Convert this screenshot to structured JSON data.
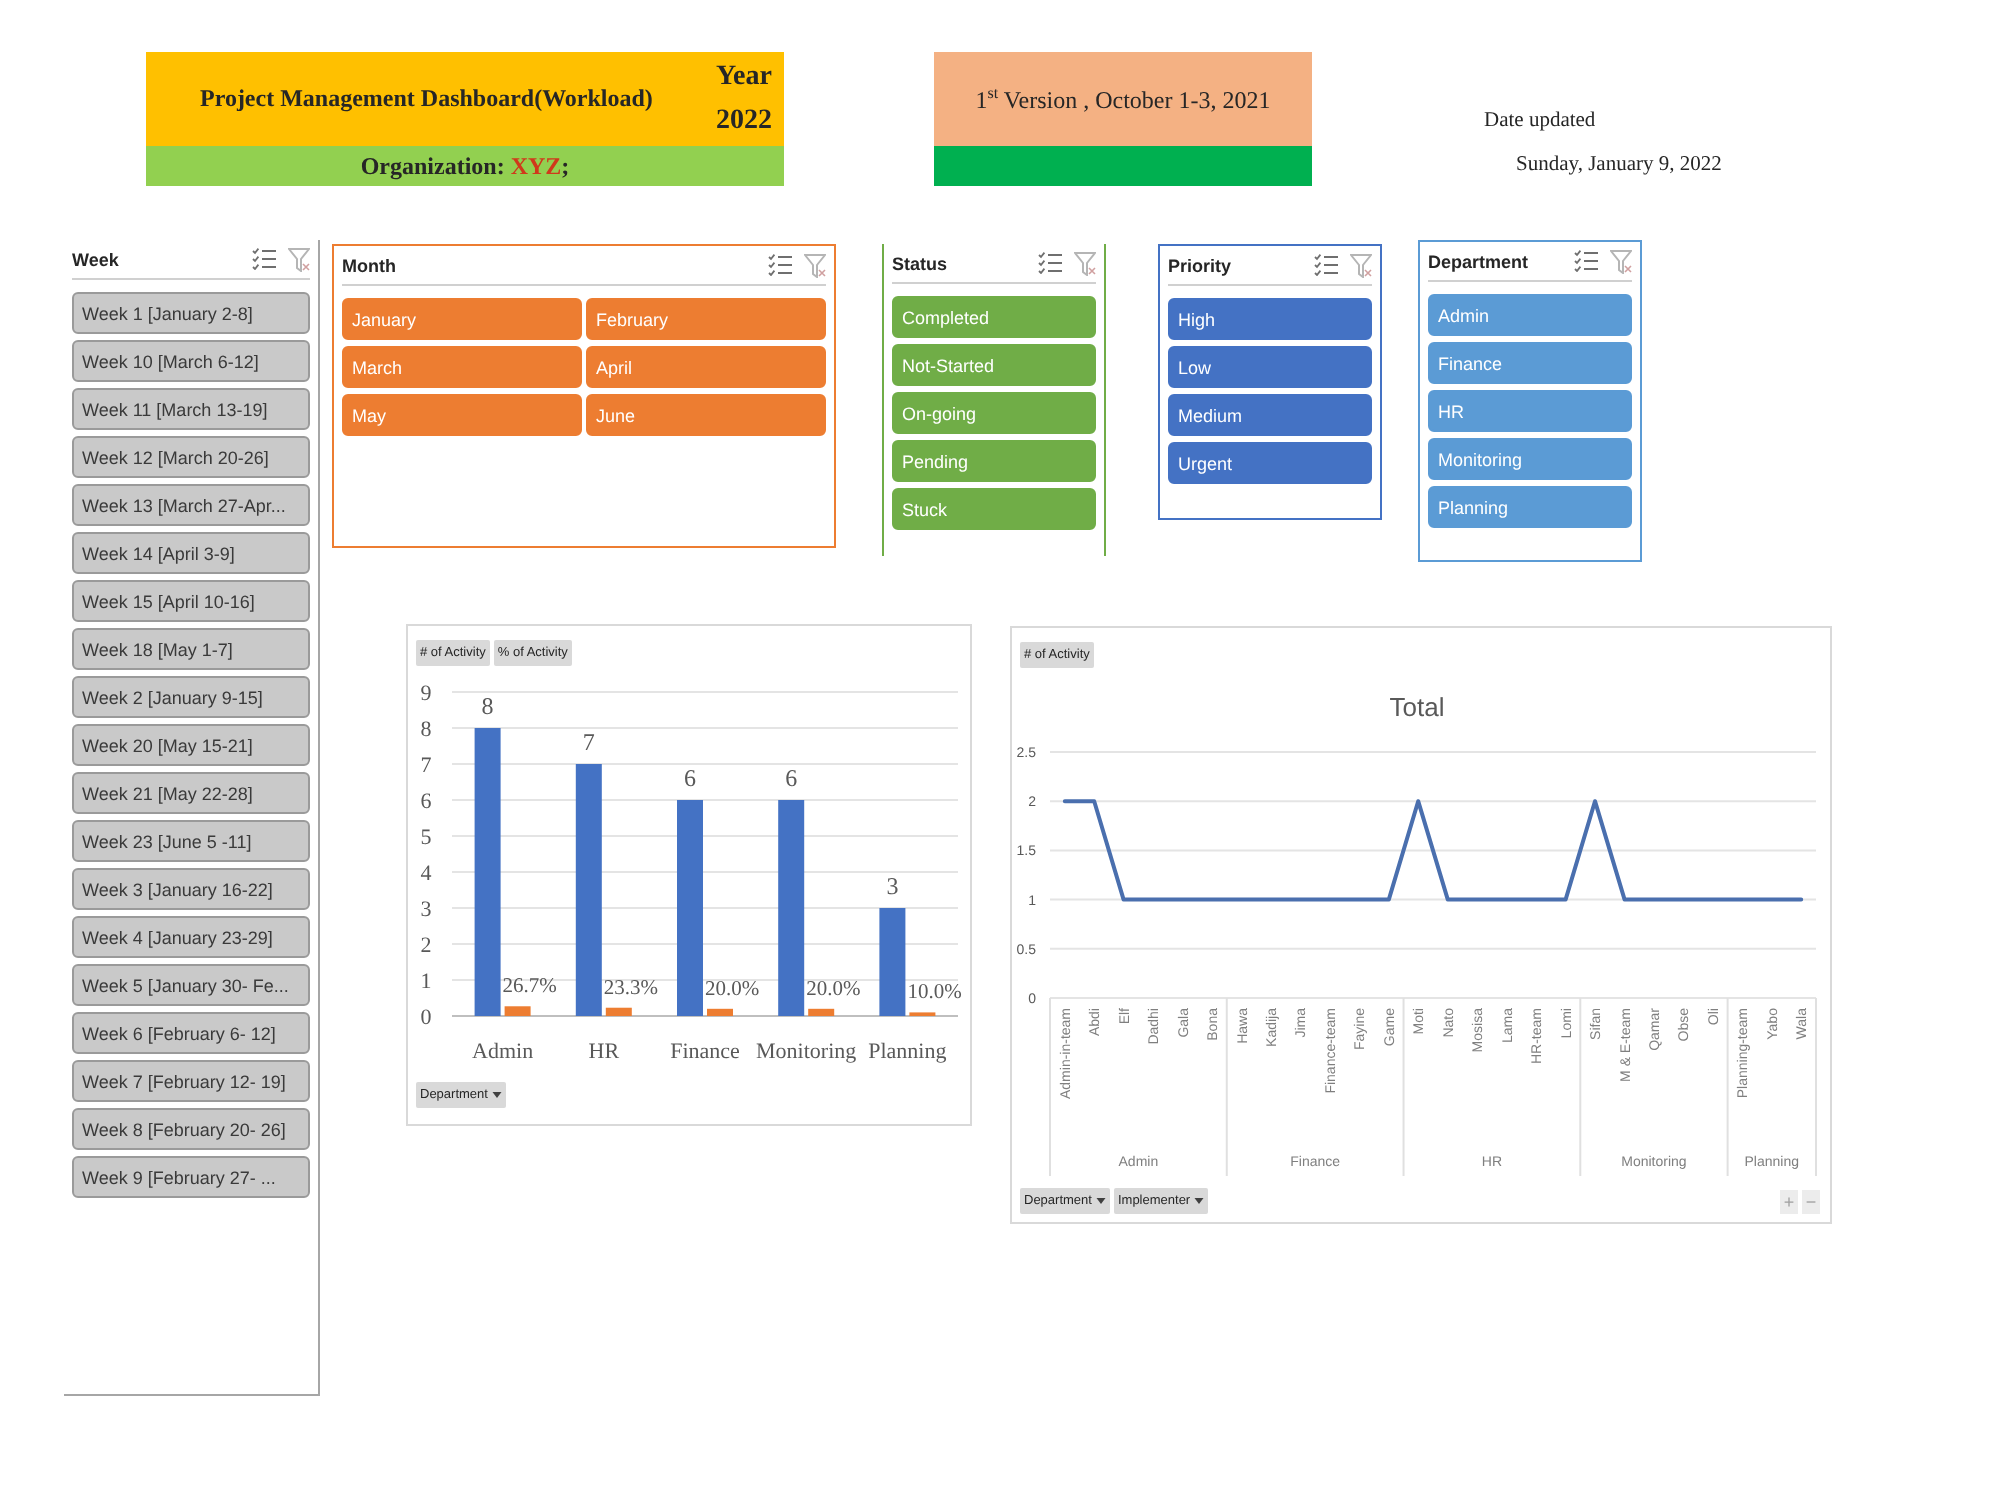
{
  "header": {
    "title": "Project Management Dashboard(Workload)",
    "year_label": "Year",
    "year": "2022",
    "organization": {
      "label": "Organization:",
      "value": "XYZ",
      "suffix": ";"
    }
  },
  "version": {
    "text": "1$^{st}$ Version , October 1-3, 2021"
  },
  "date_updated": {
    "label": "Date updated",
    "value": "Sunday, January 9, 2022"
  },
  "week_slicer": {
    "title": "Week",
    "items": [
      {
        "label": "Week 1 [January 2-8]",
        "selected": true
      },
      {
        "label": "Week 10 [March 6-12]",
        "selected": true
      },
      {
        "label": "Week 11 [March 13-19]",
        "selected": true
      },
      {
        "label": "Week 12 [March 20-26]",
        "selected": true
      },
      {
        "label": "Week 13 [March 27-Apr...",
        "selected": true
      },
      {
        "label": "Week 14 [April 3-9]",
        "selected": true
      },
      {
        "label": "Week 15 [April 10-16]",
        "selected": true
      },
      {
        "label": "Week 18 [May 1-7]",
        "selected": true
      },
      {
        "label": "Week 2 [January 9-15]",
        "selected": true
      },
      {
        "label": "Week 20 [May 15-21]",
        "selected": true
      },
      {
        "label": "Week 21 [May 22-28]",
        "selected": true
      },
      {
        "label": "Week 23 [June 5 -11]",
        "selected": true
      },
      {
        "label": "Week 3 [January 16-22]",
        "selected": true
      },
      {
        "label": "Week 4 [January 23-29]",
        "selected": true
      },
      {
        "label": "Week 5 [January 30- Fe...",
        "selected": true
      },
      {
        "label": "Week 6 [February 6- 12]",
        "selected": true
      },
      {
        "label": "Week 7 [February 12- 19]",
        "selected": true
      },
      {
        "label": "Week 8 [February 20- 26]",
        "selected": true
      },
      {
        "label": "Week 9 [February 27- ...",
        "selected": true
      }
    ]
  },
  "filter_slicers": [
    {
      "title": "Month",
      "kind": "grid",
      "color": "#ed7d31",
      "items": [
        {
          "label": "January",
          "selected": true
        },
        {
          "label": "February",
          "selected": true
        },
        {
          "label": "March",
          "selected": true
        },
        {
          "label": "April",
          "selected": true
        },
        {
          "label": "May",
          "selected": true
        },
        {
          "label": "June",
          "selected": true
        }
      ]
    },
    {
      "title": "Status",
      "kind": "strip",
      "color": "#70ad47",
      "items": [
        {
          "label": "Completed",
          "selected": true
        },
        {
          "label": "Not-Started",
          "selected": true
        },
        {
          "label": "On-going",
          "selected": true
        },
        {
          "label": "Pending",
          "selected": true
        },
        {
          "label": "Stuck",
          "selected": true
        }
      ]
    },
    {
      "title": "Priority",
      "kind": "list",
      "color": "#4472c4",
      "items": [
        {
          "label": "High",
          "selected": true
        },
        {
          "label": "Low",
          "selected": true
        },
        {
          "label": "Medium",
          "selected": true
        },
        {
          "label": "Urgent",
          "selected": true
        }
      ]
    },
    {
      "title": "Department",
      "kind": "list",
      "color": "#5b9bd5",
      "items": [
        {
          "label": "Admin",
          "selected": true
        },
        {
          "label": "Finance",
          "selected": true
        },
        {
          "label": "HR",
          "selected": true
        },
        {
          "label": "Monitoring",
          "selected": true
        },
        {
          "label": "Planning",
          "selected": true
        }
      ]
    }
  ],
  "activity_by_department": {
    "axis_buttons": [
      "Department"
    ],
    "chart_data": {
      "type": "bar",
      "categories": [
        "Admin",
        "HR",
        "Finance",
        "Monitoring",
        "Planning"
      ],
      "series": [
        {
          "name": "# of Activity",
          "color": "#4472c4",
          "values": [
            8,
            7,
            6,
            6,
            3
          ]
        },
        {
          "name": "% of Activity",
          "color": "#ed7d31",
          "values": [
            0.27,
            0.23,
            0.2,
            0.2,
            0.1
          ]
        }
      ],
      "ylim": [
        0,
        9
      ],
      "yticks": [
        0,
        1,
        2,
        3,
        4,
        5,
        6,
        7,
        8,
        9
      ],
      "grid": true,
      "value_labels": [
        [
          "8",
          "7",
          "6",
          "6",
          "3"
        ],
        [
          "26.7%",
          "23.3%",
          "20.0%",
          "20.0%",
          "10.0%"
        ]
      ]
    }
  },
  "activity_by_implementer": {
    "axis_buttons": [
      "Department",
      "Implementer"
    ],
    "zoom_buttons": [
      "+",
      "−"
    ],
    "chart_data": {
      "type": "line",
      "title": "Total",
      "categories": [
        "Admin-in-team",
        "Abdi",
        "Elf",
        "Dadhi",
        "Gala",
        "Bona",
        "Hawa",
        "Kadija",
        "Jima",
        "Finance-team",
        "Fayine",
        "Game",
        "Moti",
        "Nato",
        "Mosisa",
        "Lama",
        "HR-team",
        "Lomi",
        "Sifan",
        "M & E-team",
        "Qamar",
        "Obse",
        "Oli",
        "Planning-team",
        "Yabo",
        "Wala"
      ],
      "series": [
        {
          "name": "# of Activity",
          "color": "#4a6fae",
          "values": [
            2,
            2,
            1,
            1,
            1,
            1,
            1,
            1,
            1,
            1,
            1,
            1,
            2,
            1,
            1,
            1,
            1,
            1,
            2,
            1,
            1,
            1,
            1,
            1,
            1,
            1
          ]
        }
      ],
      "ylim": [
        0,
        2.5
      ],
      "yticks": [
        0,
        0.5,
        1,
        1.5,
        2,
        2.5
      ],
      "grid": true,
      "annotations": [
        "Admin",
        "Finance",
        "HR",
        "Monitoring",
        "Planning"
      ]
    }
  }
}
